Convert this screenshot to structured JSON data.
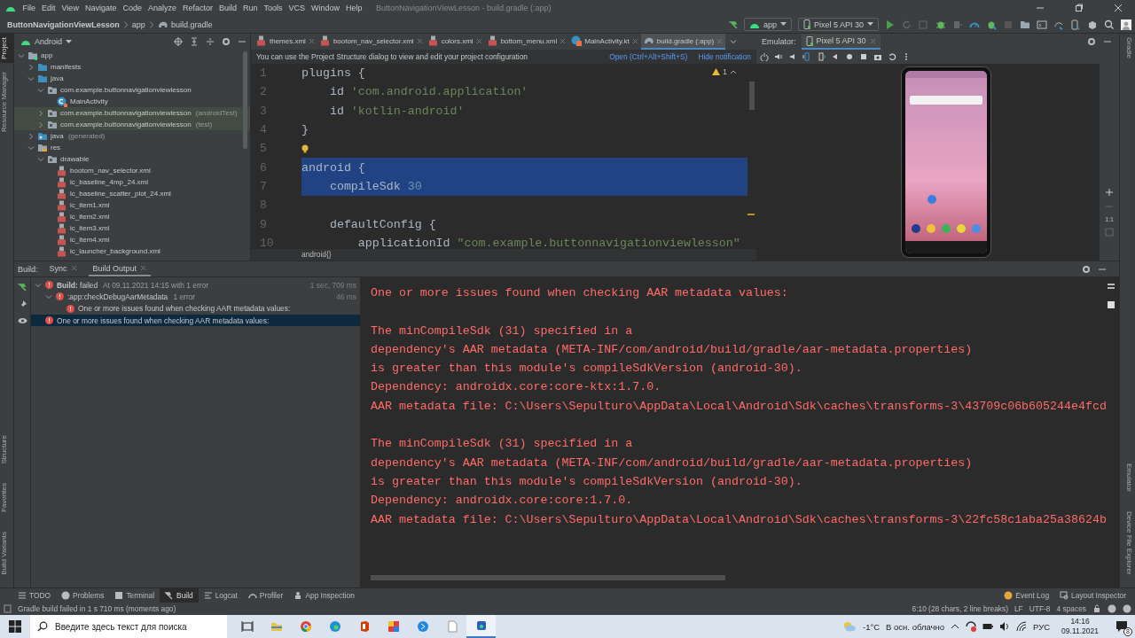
{
  "menu_bar": {
    "items": [
      "File",
      "Edit",
      "View",
      "Navigate",
      "Code",
      "Analyze",
      "Refactor",
      "Build",
      "Run",
      "Tools",
      "VCS",
      "Window",
      "Help"
    ],
    "title": "ButtonNavigationViewLesson - build.gradle (:app)"
  },
  "nav_bar": {
    "breadcrumb": [
      "ButtonNavigationViewLesson",
      "app",
      "build.gradle"
    ],
    "run_config": "app",
    "device": "Pixel 5 API 30"
  },
  "left_strip": {
    "top": [
      {
        "label": "Project",
        "selected": true
      },
      {
        "label": "Resource Manager",
        "selected": false
      }
    ],
    "bottom": [
      {
        "label": "Structure",
        "selected": false
      },
      {
        "label": "Favorites",
        "selected": false
      },
      {
        "label": "Build Variants",
        "selected": false
      }
    ]
  },
  "right_strip": {
    "top": [
      {
        "label": "Gradle",
        "selected": false
      }
    ],
    "bottom": [
      {
        "label": "Emulator",
        "selected": false
      },
      {
        "label": "Device File Explorer",
        "selected": false
      }
    ]
  },
  "project_panel": {
    "view": "Android",
    "tree": [
      {
        "label": "app",
        "kind": "module",
        "expanded": true,
        "children": [
          {
            "label": "manifests",
            "kind": "folder",
            "expanded": false
          },
          {
            "label": "java",
            "kind": "folder",
            "expanded": true,
            "children": [
              {
                "label": "com.example.buttonnavigationviewlesson",
                "kind": "package",
                "expanded": true,
                "tinted": false,
                "children": [
                  {
                    "label": "MainActivity",
                    "kind": "class"
                  }
                ]
              },
              {
                "label": "com.example.buttonnavigationviewlesson",
                "note": "(androidTest)",
                "kind": "package",
                "expanded": false,
                "tinted": true
              },
              {
                "label": "com.example.buttonnavigationviewlesson",
                "note": "(test)",
                "kind": "package",
                "expanded": false,
                "tinted": true
              }
            ]
          },
          {
            "label": "java",
            "note": "(generated)",
            "kind": "generated",
            "expanded": false
          },
          {
            "label": "res",
            "kind": "res",
            "expanded": true,
            "children": [
              {
                "label": "drawable",
                "kind": "package",
                "expanded": true,
                "children": [
                  {
                    "label": "bootom_nav_selector.xml",
                    "kind": "xml"
                  },
                  {
                    "label": "ic_baseline_4mp_24.xml",
                    "kind": "xml"
                  },
                  {
                    "label": "ic_baseline_scatter_plot_24.xml",
                    "kind": "xml"
                  },
                  {
                    "label": "ic_item1.xml",
                    "kind": "xml"
                  },
                  {
                    "label": "ic_item2.xml",
                    "kind": "xml"
                  },
                  {
                    "label": "ic_item3.xml",
                    "kind": "xml"
                  },
                  {
                    "label": "ic_item4.xml",
                    "kind": "xml"
                  },
                  {
                    "label": "ic_launcher_background.xml",
                    "kind": "xml"
                  }
                ]
              }
            ]
          }
        ]
      }
    ]
  },
  "editor": {
    "tabs": [
      {
        "label": "themes.xml",
        "kind": "xml",
        "selected": false
      },
      {
        "label": "bootom_nav_selector.xml",
        "kind": "xml",
        "selected": false
      },
      {
        "label": "colors.xml",
        "kind": "xml",
        "selected": false
      },
      {
        "label": "bottom_menu.xml",
        "kind": "xml",
        "selected": false
      },
      {
        "label": "MainActivity.kt",
        "kind": "kotlin",
        "selected": false
      },
      {
        "label": "build.gradle (:app)",
        "kind": "gradle",
        "selected": true
      }
    ],
    "notification": {
      "text": "You can use the Project Structure dialog to view and edit your project configuration",
      "actions": [
        "Open (Ctrl+Alt+Shift+S)",
        "Hide notification"
      ]
    },
    "warnings": "1",
    "lines": [
      {
        "number": "1",
        "selected": false,
        "tokens": [
          {
            "text": "plugins {",
            "kind": "plain"
          }
        ]
      },
      {
        "number": "2",
        "selected": false,
        "tokens": [
          {
            "text": "    id ",
            "kind": "plain"
          },
          {
            "text": "'com.android.application'",
            "kind": "string"
          }
        ]
      },
      {
        "number": "3",
        "selected": false,
        "tokens": [
          {
            "text": "    id ",
            "kind": "plain"
          },
          {
            "text": "'kotlin-android'",
            "kind": "string"
          }
        ]
      },
      {
        "number": "4",
        "selected": false,
        "tokens": [
          {
            "text": "}",
            "kind": "plain"
          }
        ]
      },
      {
        "number": "5",
        "selected": false,
        "bulb": true
      },
      {
        "number": "6",
        "selected": true,
        "tokens": [
          {
            "text": "android {",
            "kind": "plain"
          }
        ]
      },
      {
        "number": "7",
        "selected": true,
        "tokens": [
          {
            "text": "    compileSdk ",
            "kind": "plain"
          },
          {
            "text": "30",
            "kind": "number"
          }
        ]
      },
      {
        "number": "8",
        "selected": false
      },
      {
        "number": "9",
        "selected": false,
        "tokens": [
          {
            "text": "    defaultConfig {",
            "kind": "plain"
          }
        ]
      },
      {
        "number": "10",
        "selected": false,
        "tokens": [
          {
            "text": "        applicationId ",
            "kind": "plain"
          },
          {
            "text": "\"com.example.buttonnavigationviewlesson\"",
            "kind": "string"
          }
        ]
      }
    ],
    "breadcrumb": "android{}"
  },
  "emulator": {
    "label": "Emulator:",
    "tabs": [
      {
        "label": "Pixel 5 API 30",
        "selected": true
      }
    ],
    "zoom_label": "1:1"
  },
  "build": {
    "label": "Build:",
    "tabs": [
      {
        "label": "Sync",
        "selected": false
      },
      {
        "label": "Build Output",
        "selected": true
      }
    ],
    "tree": [
      {
        "label": "**Build:** failed",
        "detail": "At 09.11.2021 14:15 with 1 error",
        "time": "1 sec, 709 ms",
        "expanded": true,
        "selected": false,
        "children": [
          {
            "label": ":app:checkDebugAarMetadata",
            "detail": "1 error",
            "time": "46 ms",
            "expanded": true,
            "selected": false,
            "children": [
              {
                "label": "One or more issues found when checking AAR metadata values:",
                "selected": false
              }
            ]
          }
        ]
      },
      {
        "label": "One or more issues found when checking AAR metadata values:",
        "selected": true
      }
    ],
    "output": [
      [
        "One or more issues found when checking AAR metadata values:"
      ],
      [
        "The minCompileSdk (31) specified in a",
        "dependency's AAR metadata (META-INF/com/android/build/gradle/aar-metadata.properties)",
        "is greater than this module's compileSdkVersion (android-30).",
        "Dependency: androidx.core:core-ktx:1.7.0.",
        "AAR metadata file: C:\\Users\\Sepulturo\\AppData\\Local\\Android\\Sdk\\caches\\transforms-3\\43709c06b605244e4fcd"
      ],
      [
        "The minCompileSdk (31) specified in a",
        "dependency's AAR metadata (META-INF/com/android/build/gradle/aar-metadata.properties)",
        "is greater than this module's compileSdkVersion (android-30).",
        "Dependency: androidx.core:core:1.7.0.",
        "AAR metadata file: C:\\Users\\Sepulturo\\AppData\\Local\\Android\\Sdk\\caches\\transforms-3\\22fc58c1aba25a38624b"
      ]
    ]
  },
  "tool_window_bar": {
    "left": [
      {
        "label": "TODO",
        "selected": false
      },
      {
        "label": "Problems",
        "selected": false
      },
      {
        "label": "Terminal",
        "selected": false
      },
      {
        "label": "Build",
        "selected": true
      },
      {
        "label": "Logcat",
        "selected": false
      },
      {
        "label": "Profiler",
        "selected": false
      },
      {
        "label": "App Inspection",
        "selected": false
      }
    ],
    "right": [
      {
        "label": "Event Log",
        "selected": false
      },
      {
        "label": "Layout Inspector",
        "selected": false
      }
    ]
  },
  "status_bar": {
    "message": "Gradle build failed in 1 s 710 ms (moments ago)",
    "items": [
      "6:10 (28 chars, 2 line breaks)",
      "LF",
      "UTF-8",
      "4 spaces"
    ]
  },
  "taskbar": {
    "search_placeholder": "Введите здесь текст для поиска",
    "temperature": "-1°C",
    "weather": "В осн. облачно",
    "language": "РУС",
    "time": "14:16",
    "date": "09.11.2021",
    "notification_count": "8"
  }
}
